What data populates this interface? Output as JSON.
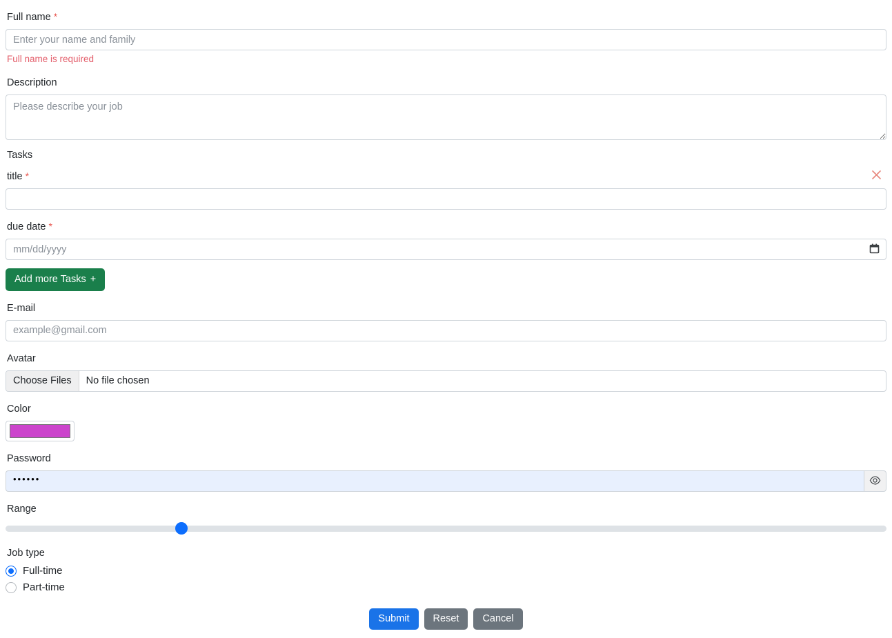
{
  "form": {
    "full_name": {
      "label": "Full name",
      "required_mark": "*",
      "placeholder": "Enter your name and family",
      "value": "",
      "error": "Full name is required"
    },
    "description": {
      "label": "Description",
      "placeholder": "Please describe your job",
      "value": ""
    },
    "tasks": {
      "group_label": "Tasks",
      "remove_icon": "close-x-icon",
      "items": [
        {
          "title_label": "title",
          "title_required_mark": "*",
          "title_value": "",
          "title_placeholder": "",
          "due_date_label": "due date",
          "due_date_required_mark": "*",
          "due_date_placeholder": "mm/dd/yyyy",
          "due_date_value": "",
          "calendar_icon": "calendar-icon"
        }
      ],
      "add_button": "Add more Tasks",
      "add_button_icon": "+"
    },
    "email": {
      "label": "E-mail",
      "placeholder": "example@gmail.com",
      "value": ""
    },
    "avatar": {
      "label": "Avatar",
      "choose_button": "Choose Files",
      "file_status": "No file chosen"
    },
    "color": {
      "label": "Color",
      "value": "#cc44cc"
    },
    "password": {
      "label": "Password",
      "value": "••••••",
      "toggle_icon": "eye-icon"
    },
    "range": {
      "label": "Range",
      "value": 20,
      "min": 0,
      "max": 100
    },
    "job_type": {
      "label": "Job type",
      "options": [
        {
          "label": "Full-time",
          "checked": true
        },
        {
          "label": "Part-time",
          "checked": false
        }
      ]
    },
    "actions": {
      "submit": "Submit",
      "reset": "Reset",
      "cancel": "Cancel"
    }
  },
  "colors": {
    "primary": "#1a73e8",
    "success": "#1a7f4b",
    "secondary": "#6c757d",
    "danger": "#e35d6a",
    "swatch": "#cc44cc",
    "range_thumb": "#0d6efd"
  }
}
